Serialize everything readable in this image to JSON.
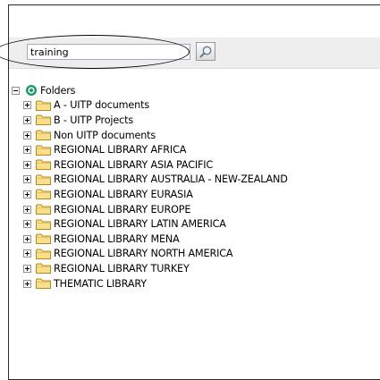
{
  "search": {
    "value": "training"
  },
  "icons": {
    "search_button": "magnifier-icon",
    "root": "folders-root-icon",
    "folder": "folder-icon"
  },
  "tree": {
    "root_label": "Folders",
    "items": [
      {
        "label": "A - UITP documents"
      },
      {
        "label": "B - UITP Projects"
      },
      {
        "label": "Non UITP documents"
      },
      {
        "label": "REGIONAL LIBRARY AFRICA"
      },
      {
        "label": "REGIONAL LIBRARY ASIA PACIFIC"
      },
      {
        "label": "REGIONAL LIBRARY AUSTRALIA - NEW-ZEALAND"
      },
      {
        "label": "REGIONAL LIBRARY EURASIA"
      },
      {
        "label": "REGIONAL LIBRARY EUROPE"
      },
      {
        "label": "REGIONAL LIBRARY LATIN AMERICA"
      },
      {
        "label": "REGIONAL LIBRARY MENA"
      },
      {
        "label": "REGIONAL LIBRARY NORTH AMERICA"
      },
      {
        "label": "REGIONAL LIBRARY TURKEY"
      },
      {
        "label": "THEMATIC LIBRARY"
      }
    ]
  },
  "colors": {
    "folder_fill": "#f8e08a",
    "folder_stroke": "#b48a1c",
    "root_icon": "#1a9a6a",
    "search_band": "#eeeeee"
  }
}
